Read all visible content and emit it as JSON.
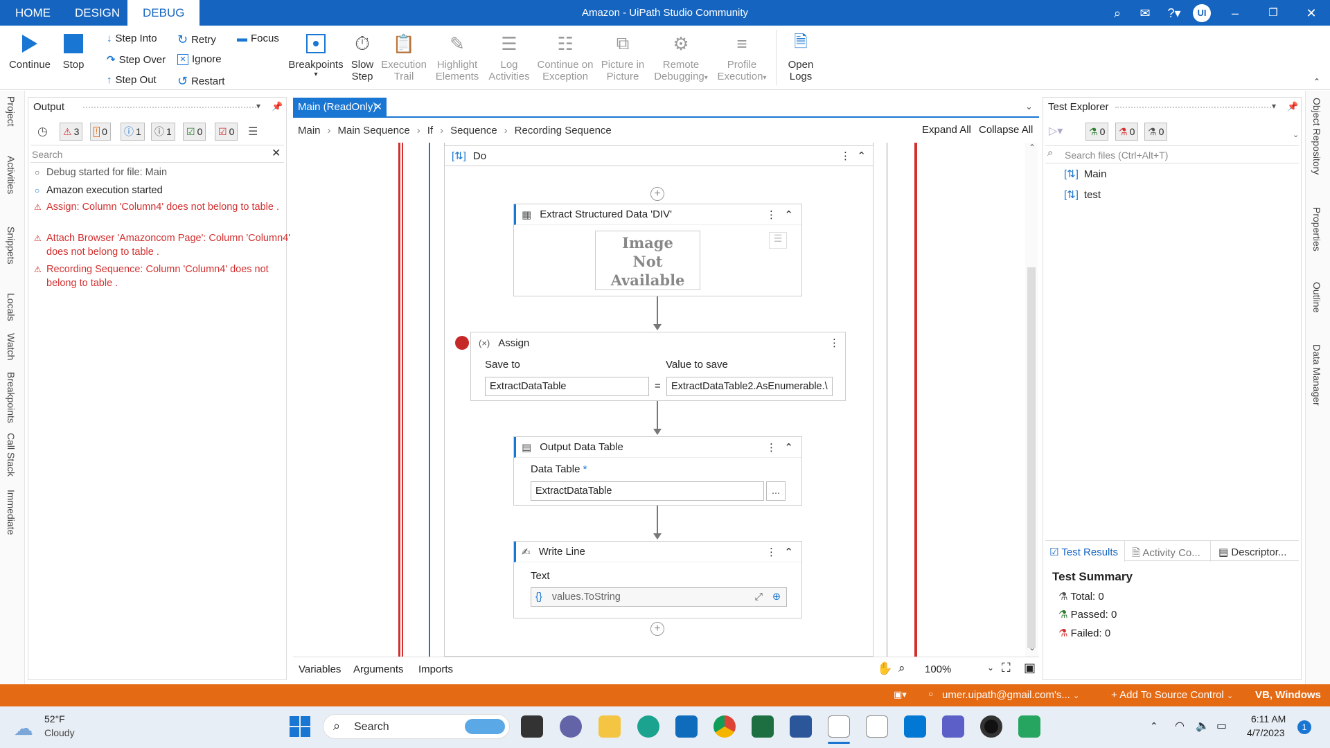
{
  "window": {
    "title": "Amazon - UiPath Studio Community",
    "user_initials": "UI"
  },
  "tabs": [
    "HOME",
    "DESIGN",
    "DEBUG"
  ],
  "ribbon": {
    "continue": "Continue",
    "stop": "Stop",
    "step_into": "Step Into",
    "step_over": "Step Over",
    "step_out": "Step Out",
    "retry": "Retry",
    "ignore": "Ignore",
    "restart": "Restart",
    "focus": "Focus",
    "breakpoints": "Breakpoints",
    "slow_step": [
      "Slow",
      "Step"
    ],
    "execution_trail": [
      "Execution",
      "Trail"
    ],
    "highlight_elements": [
      "Highlight",
      "Elements"
    ],
    "log_activities": [
      "Log",
      "Activities"
    ],
    "continue_on_exception": [
      "Continue on",
      "Exception"
    ],
    "picture_in_picture": [
      "Picture in",
      "Picture"
    ],
    "remote_debugging": [
      "Remote",
      "Debugging"
    ],
    "profile_execution": [
      "Profile",
      "Execution"
    ],
    "open_logs": [
      "Open",
      "Logs"
    ]
  },
  "left_rail": [
    "Project",
    "Activities",
    "Snippets",
    "Locals",
    "Watch",
    "Breakpoints",
    "Call Stack",
    "Immediate"
  ],
  "output": {
    "title": "Output",
    "counts": {
      "errors": "3",
      "warnings": "0",
      "info": "1",
      "trace": "1",
      "success": "0",
      "failed": "0"
    },
    "search_placeholder": "Search",
    "logs": [
      {
        "type": "debug",
        "text": "Debug started for file: Main"
      },
      {
        "type": "info",
        "text": "Amazon execution started"
      },
      {
        "type": "error",
        "text": "Assign: Column 'Column4' does not belong to table ."
      },
      {
        "type": "error",
        "text": "Attach Browser 'Amazoncom Page': Column 'Column4' does not belong to table ."
      },
      {
        "type": "error",
        "text": "Recording Sequence: Column 'Column4' does not belong to table ."
      }
    ]
  },
  "designer": {
    "tab_title": "Main (ReadOnly)",
    "breadcrumb": [
      "Main",
      "Main Sequence",
      "If",
      "Sequence",
      "Recording Sequence"
    ],
    "expand_all": "Expand All",
    "collapse_all": "Collapse All",
    "do_label": "Do",
    "extract": {
      "title": "Extract Structured Data 'DIV'",
      "image_text": [
        "Image",
        "Not",
        "Available"
      ]
    },
    "assign": {
      "title": "Assign",
      "save_to_label": "Save to",
      "value_label": "Value to save",
      "save_to": "ExtractDataTable",
      "equals": "=",
      "value": "ExtractDataTable2.AsEnumerable.\\"
    },
    "output_dt": {
      "title": "Output Data Table",
      "field_label": "Data Table",
      "required": "*",
      "value": "ExtractDataTable",
      "browse": "..."
    },
    "write_line": {
      "title": "Write Line",
      "field_label": "Text",
      "value": "values.ToString"
    },
    "bottom_tabs": [
      "Variables",
      "Arguments",
      "Imports"
    ],
    "zoom": "100%"
  },
  "test_explorer": {
    "title": "Test Explorer",
    "counts": [
      "0",
      "0",
      "0"
    ],
    "search_placeholder": "Search files (Ctrl+Alt+T)",
    "files": [
      "Main",
      "test"
    ],
    "bottom_tabs": [
      "Test Results",
      "Activity Co...",
      "Descriptor..."
    ],
    "summary_title": "Test Summary",
    "total": "Total: 0",
    "passed": "Passed: 0",
    "failed": "Failed: 0"
  },
  "right_rail": [
    "Object Repository",
    "Properties",
    "Outline",
    "Data Manager"
  ],
  "statusbar": {
    "account": "umer.uipath@gmail.com's...",
    "source_control": "Add To Source Control",
    "lang": "VB, Windows"
  },
  "taskbar": {
    "temp": "52°F",
    "weather": "Cloudy",
    "search": "Search",
    "time": "6:11 AM",
    "date": "4/7/2023",
    "notif": "1"
  },
  "colors": {
    "accent": "#1565c0",
    "status": "#e56a14",
    "error": "#d32f2f"
  }
}
